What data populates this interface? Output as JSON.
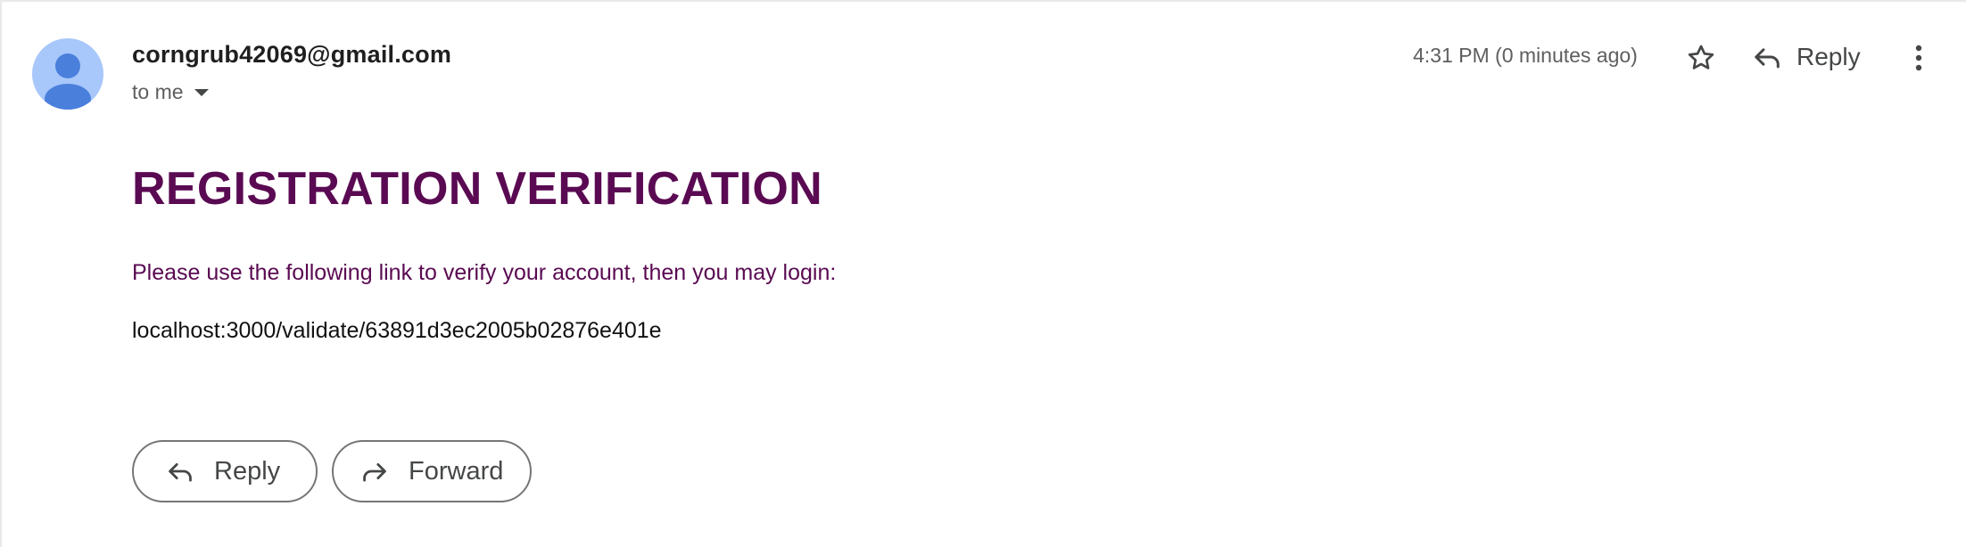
{
  "message": {
    "sender": "corngrub42069@gmail.com",
    "recipient_label": "to me",
    "timestamp": "4:31 PM (0 minutes ago)"
  },
  "toolbar": {
    "reply_label": "Reply",
    "icons": [
      "person-avatar-icon",
      "caret-down-icon",
      "star-icon",
      "reply-icon",
      "more-vert-icon"
    ]
  },
  "body": {
    "title": "REGISTRATION VERIFICATION",
    "message": "Please use the following link to verify your account, then you may login:",
    "link": "localhost:3000/validate/63891d3ec2005b02876e401e"
  },
  "actions": {
    "reply_label": "Reply",
    "forward_label": "Forward",
    "icons": [
      "reply-icon",
      "forward-icon"
    ]
  },
  "colors": {
    "title": "#5a0a52",
    "avatar_bg": "#a8c7fa",
    "avatar_fg": "#4a7fdc"
  }
}
